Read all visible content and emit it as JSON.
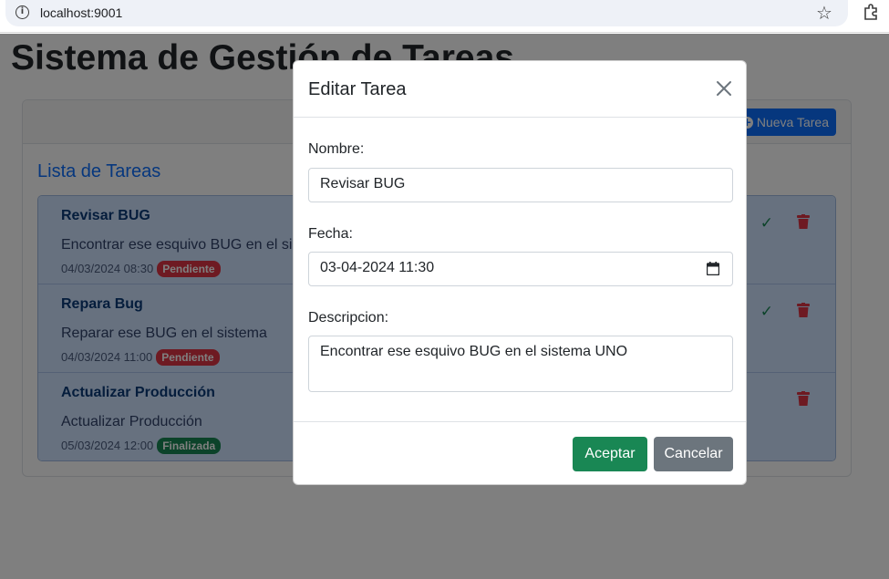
{
  "browser": {
    "url": "localhost:9001"
  },
  "page": {
    "title": "Sistema de Gestión de Tareas",
    "new_task_label": "Nueva Tarea",
    "list_title": "Lista de Tareas"
  },
  "tasks": [
    {
      "name": "Revisar BUG",
      "description": "Encontrar ese esquivo BUG en el sistema UNO",
      "date": "04/03/2024 08:30",
      "status": "Pendiente"
    },
    {
      "name": "Repara Bug",
      "description": "Reparar ese BUG en el sistema",
      "date": "04/03/2024 11:00",
      "status": "Pendiente"
    },
    {
      "name": "Actualizar Producción",
      "description": "Actualizar Producción",
      "date": "05/03/2024 12:00",
      "status": "Finalizada"
    }
  ],
  "modal": {
    "title": "Editar Tarea",
    "name_label": "Nombre:",
    "name_value": "Revisar BUG",
    "date_label": "Fecha:",
    "date_value": "03-04-2024 11:30",
    "description_label": "Descripcion:",
    "description_value": "Encontrar ese esquivo BUG en el sistema UNO",
    "accept_label": "Aceptar",
    "cancel_label": "Cancelar"
  },
  "colors": {
    "primary": "#0d6efd",
    "success": "#198754",
    "danger": "#dc3545",
    "secondary": "#6c757d",
    "task_bg": "#cfe2ff"
  }
}
